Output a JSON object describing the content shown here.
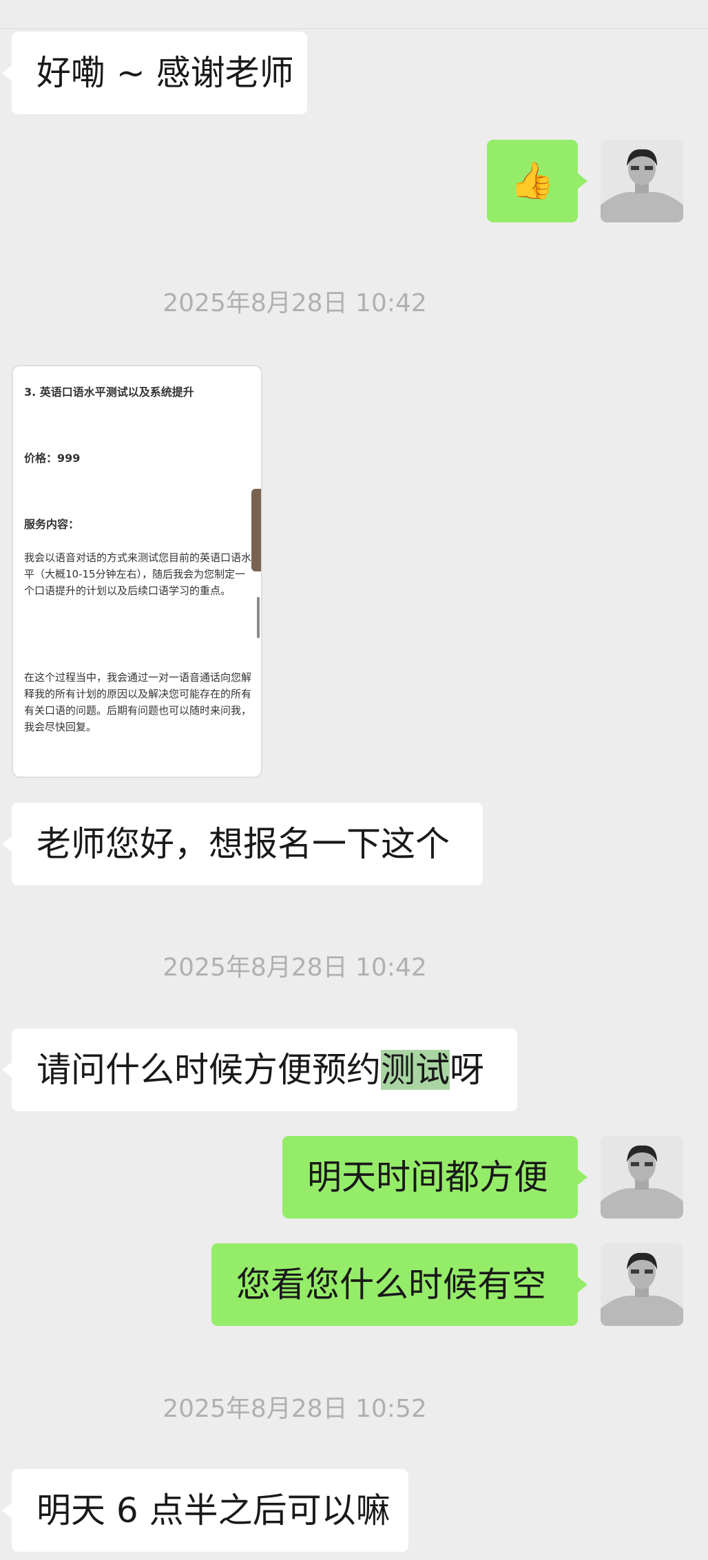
{
  "messages": {
    "m1": "好嘞 ~ 感谢老师",
    "m2": "老师您好，想报名一下这个",
    "m3_before": "请问什么时候方便预约",
    "m3_highlight": "测试",
    "m3_after": "呀",
    "m4": "明天时间都方便",
    "m5": "您看您什么时候有空",
    "m6": "明天 6 点半之后可以嘛"
  },
  "timestamps": {
    "t1": "2025年8月28日 10:42",
    "t2": "2025年8月28日 10:42",
    "t3": "2025年8月28日 10:52"
  },
  "emoji": {
    "thumbs_up": "👍"
  },
  "card": {
    "title": "3. 英语口语水平测试以及系统提升",
    "price": "价格：999",
    "service_heading": "服务内容：",
    "paragraph1": "我会以语音对话的方式来测试您目前的英语口语水平（大概10-15分钟左右），随后我会为您制定一个口语提升的计划以及后续口语学习的重点。",
    "paragraph2": "在这个过程当中，我会通过一对一语音通话向您解释我的所有计划的原因以及解决您可能存在的所有有关口语的问题。后期有问题也可以随时来问我，我会尽快回复。"
  },
  "colors": {
    "background": "#ededed",
    "incoming_bubble": "#ffffff",
    "outgoing_bubble": "#95ec69",
    "highlight": "#a9d5a3",
    "timestamp_text": "#b0b0b0"
  }
}
